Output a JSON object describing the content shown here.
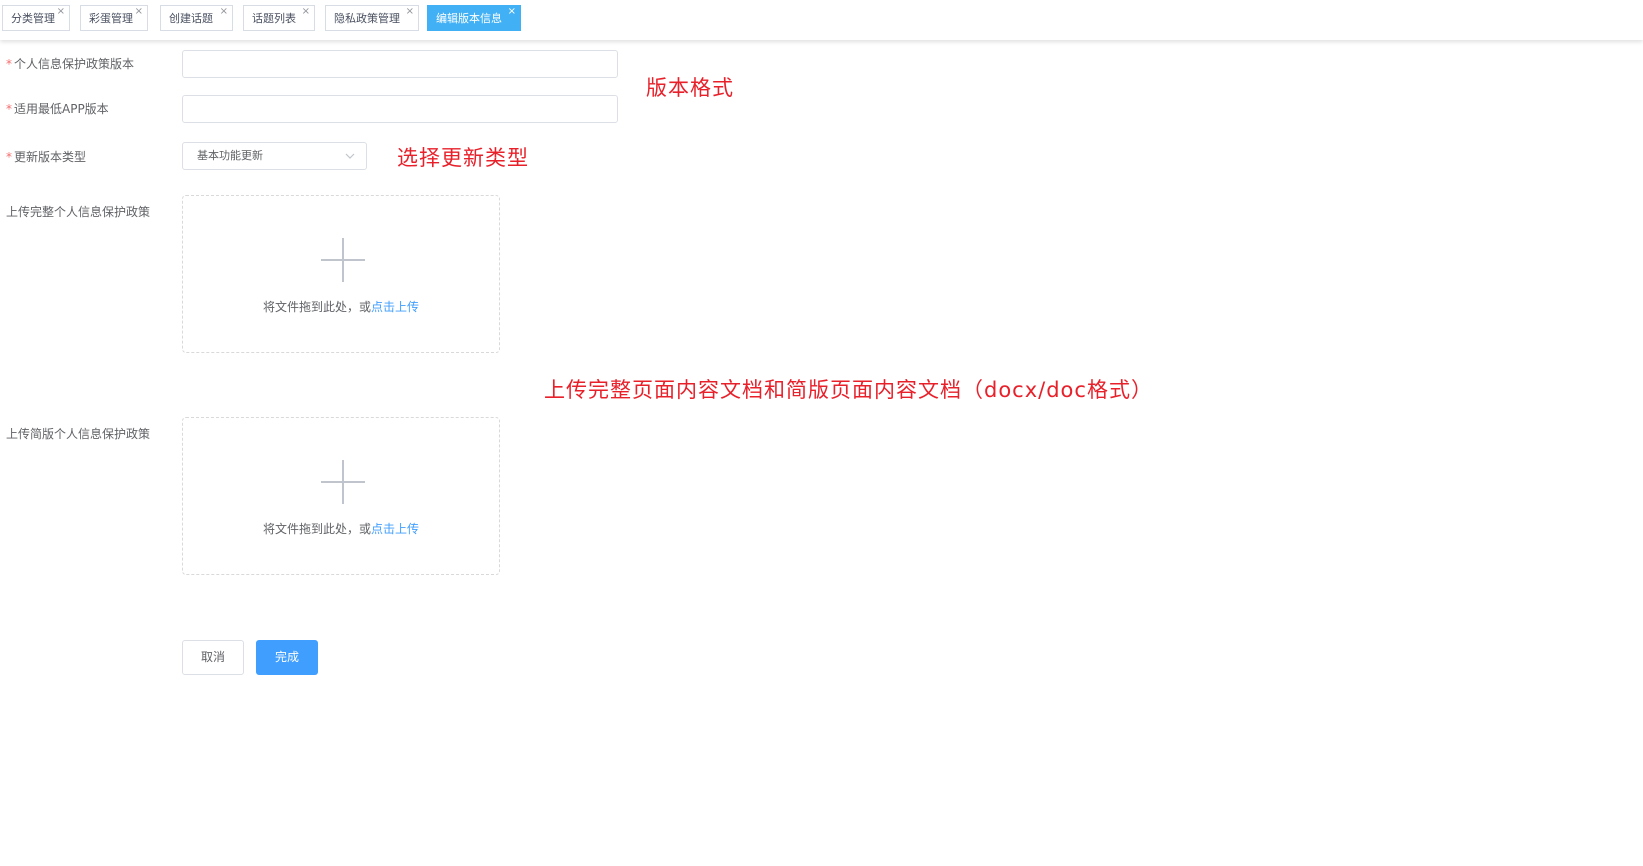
{
  "tabs": [
    {
      "label": "分类管理",
      "active": false
    },
    {
      "label": "彩蛋管理",
      "active": false
    },
    {
      "label": "创建话题",
      "active": false
    },
    {
      "label": "话题列表",
      "active": false
    },
    {
      "label": "隐私政策管理",
      "active": false
    },
    {
      "label": "编辑版本信息",
      "active": true
    }
  ],
  "tab_close_symbol": "×",
  "form": {
    "required_mark": "*",
    "privacy_version": {
      "label": "个人信息保护政策版本",
      "value": "",
      "required": true
    },
    "min_app_version": {
      "label": "适用最低APP版本",
      "value": "",
      "required": true
    },
    "update_type": {
      "label": "更新版本类型",
      "selected": "基本功能更新",
      "required": true
    },
    "upload_full": {
      "label": "上传完整个人信息保护政策",
      "hint": "将文件拖到此处，或",
      "link": "点击上传"
    },
    "upload_brief": {
      "label": "上传简版个人信息保护政策",
      "hint": "将文件拖到此处，或",
      "link": "点击上传"
    }
  },
  "annotations": {
    "version_format": "版本格式",
    "select_type": "选择更新类型",
    "upload_docs": "上传完整页面内容文档和简版页面内容文档（docx/doc格式）"
  },
  "buttons": {
    "cancel": "取消",
    "done": "完成"
  },
  "colors": {
    "primary": "#409eff",
    "active_tab": "#42b0f5",
    "required": "#f56c6c",
    "annotation": "#e8202a"
  },
  "icons": {
    "upload": "plus-icon",
    "select": "chevron-down-icon",
    "tab_close": "close-icon"
  }
}
